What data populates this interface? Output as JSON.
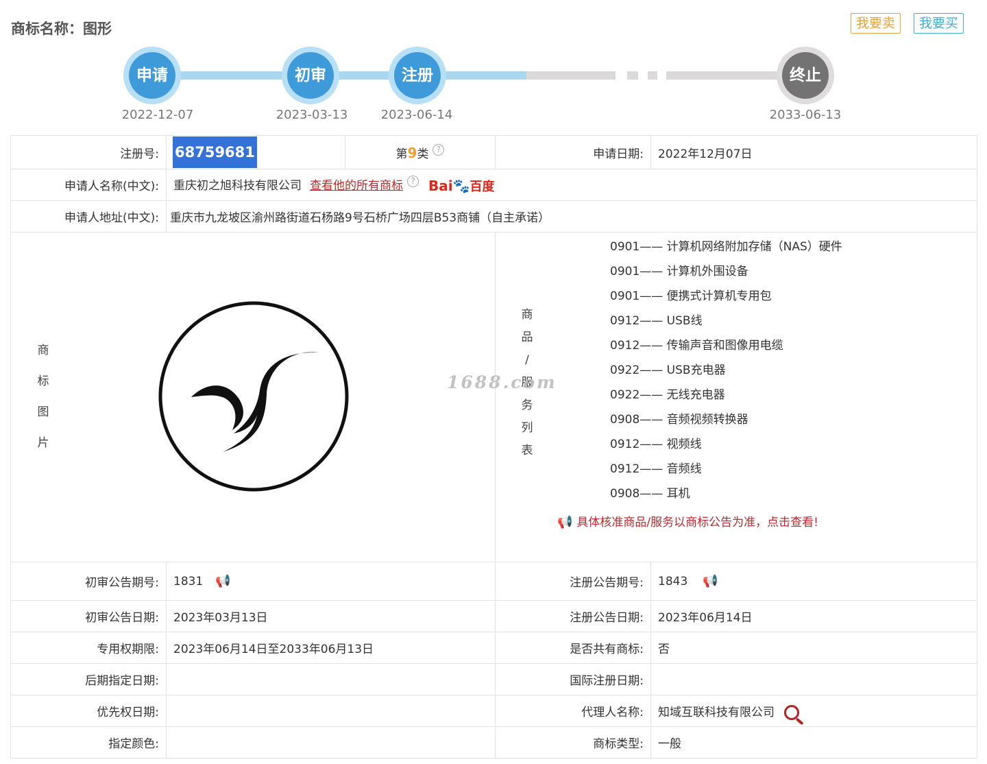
{
  "header": {
    "title": "商标名称：图形",
    "sell_label": "我要卖",
    "buy_label": "我要买"
  },
  "timeline": {
    "steps": [
      {
        "label": "申请",
        "date": "2022-12-07"
      },
      {
        "label": "初审",
        "date": "2023-03-13"
      },
      {
        "label": "注册",
        "date": "2023-06-14"
      },
      {
        "label": "终止",
        "date": "2033-06-13"
      }
    ]
  },
  "info": {
    "reg_no_label": "注册号:",
    "reg_no": "68759681",
    "class_prefix": "第",
    "class_num": "9",
    "class_suffix": "类",
    "help_glyph": "?",
    "apply_date_label": "申请日期:",
    "apply_date": "2022年12月07日",
    "applicant_label": "申请人名称(中文):",
    "applicant": "重庆初之旭科技有限公司",
    "all_marks_link": "查看他的所有商标",
    "baidu_text": "Bai",
    "baidu_cn": "百度",
    "address_label": "申请人地址(中文):",
    "address": "重庆市九龙坡区渝州路街道石杨路9号石桥广场四层B53商铺（自主承诺）",
    "image_label": [
      "商",
      "标",
      "图",
      "片"
    ],
    "goods_label": [
      "商",
      "品",
      "/",
      "服",
      "务",
      "列",
      "表"
    ],
    "goods": [
      "0901—— 计算机网络附加存储（NAS）硬件",
      "0901—— 计算机外围设备",
      "0901—— 便携式计算机专用包",
      "0912—— USB线",
      "0912—— 传输声音和图像用电缆",
      "0922—— USB充电器",
      "0922—— 无线充电器",
      "0908—— 音频视频转换器",
      "0912—— 视频线",
      "0912—— 音频线",
      "0908—— 耳机"
    ],
    "goods_notice": "具体核准商品/服务以商标公告为准，点击查看!",
    "prelim_issue_label": "初审公告期号:",
    "prelim_issue": "1831",
    "reg_issue_label": "注册公告期号:",
    "reg_issue": "1843",
    "prelim_date_label": "初审公告日期:",
    "prelim_date": "2023年03月13日",
    "reg_date_label": "注册公告日期:",
    "reg_date": "2023年06月14日",
    "term_label": "专用权期限:",
    "term": "2023年06月14日至2033年06月13日",
    "shared_label": "是否共有商标:",
    "shared": "否",
    "later_label": "后期指定日期:",
    "later": "",
    "intl_label": "国际注册日期:",
    "intl": "",
    "priority_label": "优先权日期:",
    "priority": "",
    "agent_label": "代理人名称:",
    "agent": "知域互联科技有限公司",
    "color_label": "指定颜色:",
    "color": "",
    "type_label": "商标类型:",
    "type": "一般"
  },
  "watermark": "1688.com",
  "colors": {
    "accent_blue": "#3f9ad9",
    "highlight_blue": "#3572d8",
    "link_red": "#c0282d",
    "sell_orange": "#e8a33a",
    "buy_cyan": "#3fb0d8"
  }
}
